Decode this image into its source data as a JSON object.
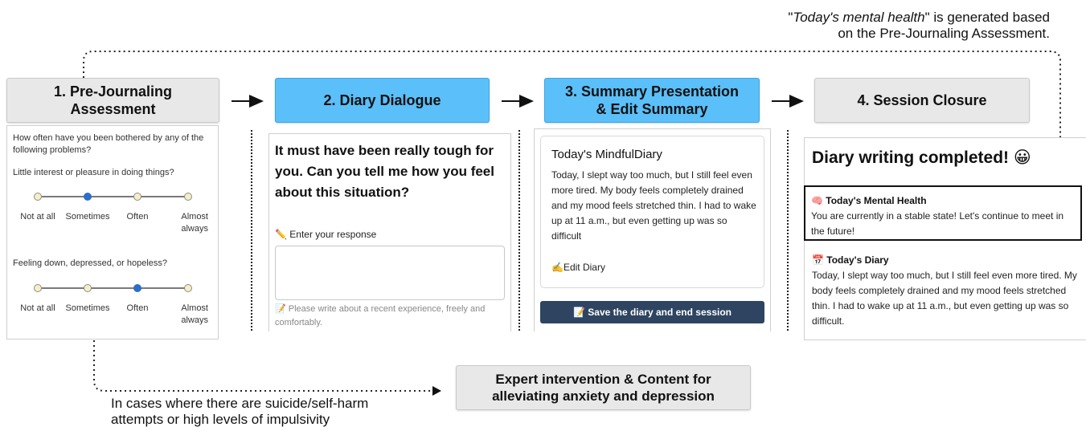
{
  "note_top": {
    "line1_q1": "\"",
    "line1_em": "Today's mental health",
    "line1_q2": "\" is generated based",
    "line2": "on the Pre-Journaling Assessment."
  },
  "steps": {
    "s1": "1. Pre-Journaling Assessment",
    "s2": "2. Diary Dialogue",
    "s3": "3. Summary Presentation & Edit Summary",
    "s4": "4. Session Closure"
  },
  "assessment": {
    "question_intro": "How often have you been bothered by any of the following problems?",
    "items": [
      {
        "text": "Little interest or pleasure in doing things?",
        "selected": "Sometimes"
      },
      {
        "text": "Feeling down, depressed, or hopeless?",
        "selected": "Often"
      }
    ],
    "options": [
      "Not at all",
      "Sometimes",
      "Often",
      "Almost always"
    ]
  },
  "dialogue": {
    "prompt": "It must have been really tough for you. Can you tell me how you feel about this situation?",
    "input_label": "✏️ Enter your response",
    "hint": "📝 Please write about a recent experience, freely and comfortably."
  },
  "summary": {
    "title": "Today's MindfulDiary",
    "text": "Today, I slept way too much, but I still feel even more tired. My body feels completely drained and my mood feels stretched thin. I had to wake up at 11 a.m., but even getting up was so difficult",
    "edit_label": "✍️Edit Diary",
    "save_label": "📝 Save the diary and end session"
  },
  "closure": {
    "heading": "Diary writing completed! 😀",
    "mh_title": "🧠 Today's Mental Health",
    "mh_text": "You are currently in a stable state! Let's continue to meet in the future!",
    "diary_title": "📅 Today's Diary",
    "diary_text": "Today, I slept way too much, but I still feel even more tired. My body feels completely drained and my mood feels stretched thin. I had to wake up at 11 a.m., but even getting up was so difficult."
  },
  "note_bottom": "In cases where there are suicide/self-harm attempts or high levels of impulsivity",
  "expert_box": "Expert intervention & Content for alleviating anxiety and depression",
  "colors": {
    "blue_step": "#5bbff9",
    "gray_step": "#e8e8e8",
    "save_button": "#2e4460",
    "selected_dot": "#2d6ec8"
  }
}
